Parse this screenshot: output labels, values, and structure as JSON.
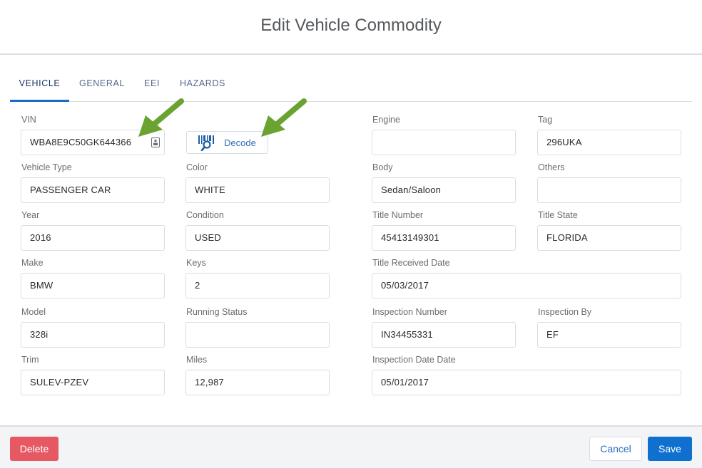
{
  "modal": {
    "title": "Edit Vehicle Commodity"
  },
  "tabs": [
    {
      "label": "VEHICLE",
      "active": true
    },
    {
      "label": "GENERAL",
      "active": false
    },
    {
      "label": "EEI",
      "active": false
    },
    {
      "label": "HAZARDS",
      "active": false
    }
  ],
  "fields": {
    "vin": {
      "label": "VIN",
      "value": "WBA8E9C50GK644366"
    },
    "vehicle_type": {
      "label": "Vehicle Type",
      "value": "PASSENGER CAR"
    },
    "year": {
      "label": "Year",
      "value": "2016"
    },
    "make": {
      "label": "Make",
      "value": "BMW"
    },
    "model": {
      "label": "Model",
      "value": "328i"
    },
    "trim": {
      "label": "Trim",
      "value": "SULEV-PZEV"
    },
    "color": {
      "label": "Color",
      "value": "WHITE"
    },
    "condition": {
      "label": "Condition",
      "value": "USED"
    },
    "keys": {
      "label": "Keys",
      "value": "2"
    },
    "running_status": {
      "label": "Running Status",
      "value": ""
    },
    "miles": {
      "label": "Miles",
      "value": "12,987"
    },
    "engine": {
      "label": "Engine",
      "value": ""
    },
    "body": {
      "label": "Body",
      "value": "Sedan/Saloon"
    },
    "title_number": {
      "label": "Title Number",
      "value": "45413149301"
    },
    "title_received_date": {
      "label": "Title Received Date",
      "value": "05/03/2017"
    },
    "inspection_number": {
      "label": "Inspection Number",
      "value": "IN34455331"
    },
    "inspection_date": {
      "label": "Inspection Date Date",
      "value": "05/01/2017"
    },
    "tag": {
      "label": "Tag",
      "value": "296UKA"
    },
    "others": {
      "label": "Others",
      "value": ""
    },
    "title_state": {
      "label": "Title State",
      "value": "FLORIDA"
    },
    "inspection_by": {
      "label": "Inspection By",
      "value": "EF"
    }
  },
  "decode_button": {
    "label": "Decode",
    "icon": "barcode-search-icon"
  },
  "footer": {
    "delete_label": "Delete",
    "cancel_label": "Cancel",
    "save_label": "Save"
  },
  "colors": {
    "accent": "#0f70d0",
    "danger": "#e65862",
    "arrow": "#6aa331",
    "tab_active": "#1b6cc9"
  }
}
